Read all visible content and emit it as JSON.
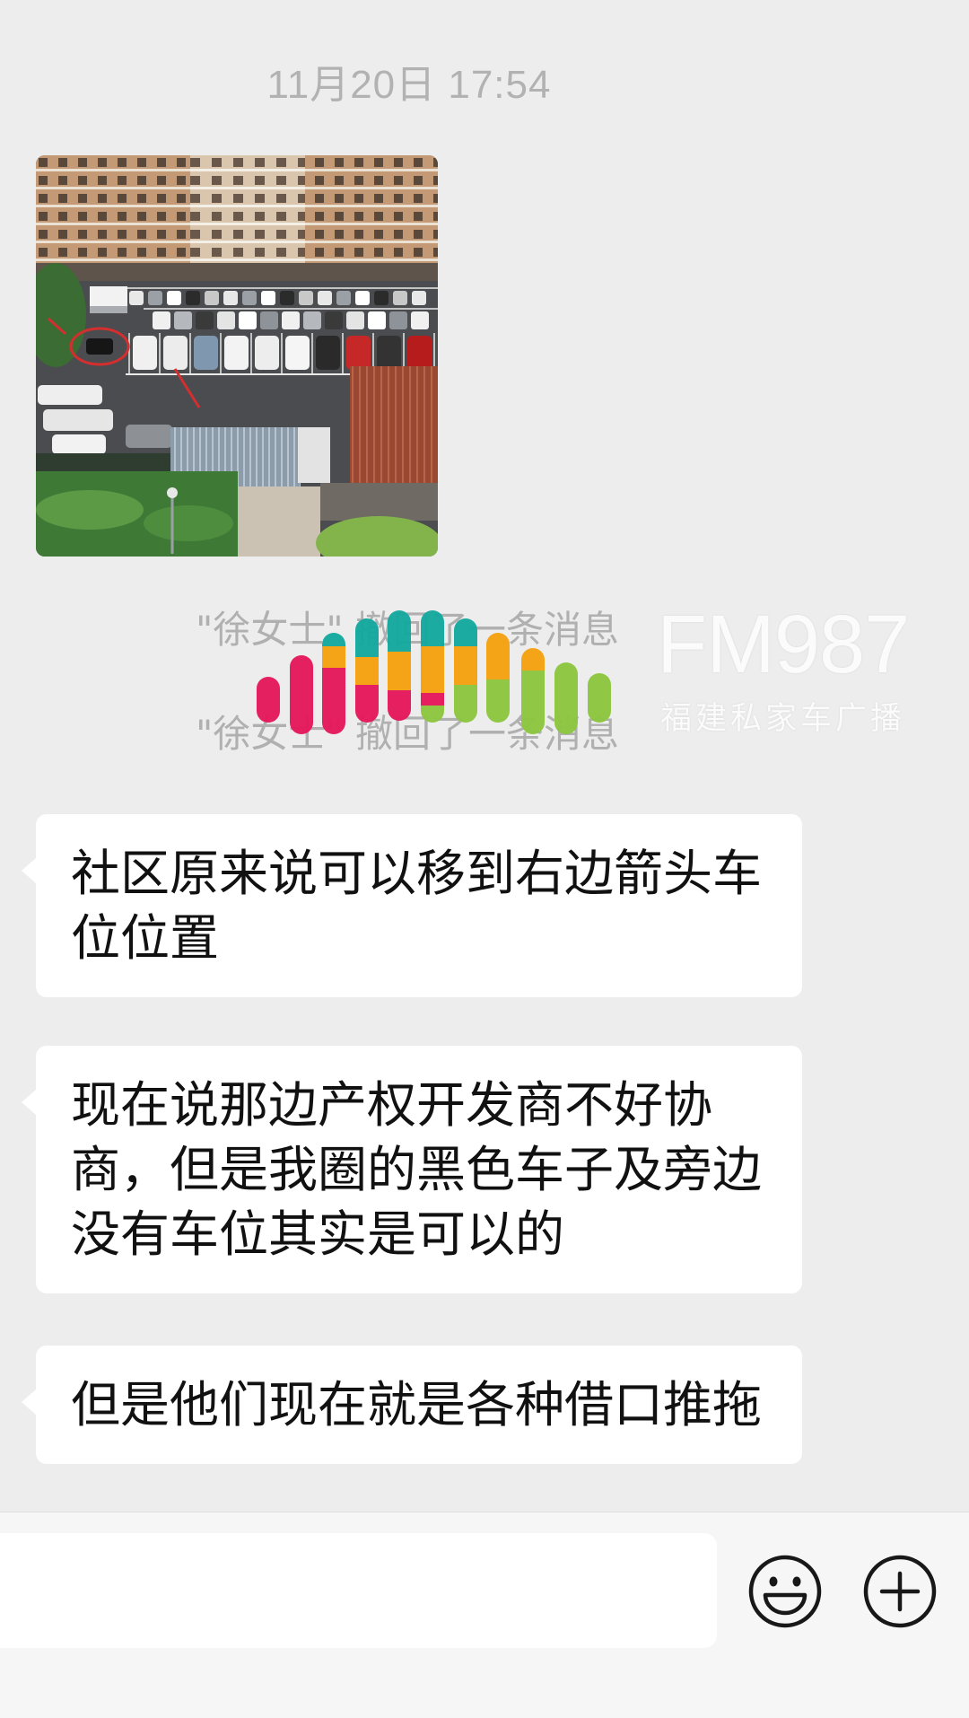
{
  "chat": {
    "timestamp": "11月20日 17:54",
    "recall_notices": [
      "\"徐女士\" 撤回了一条消息",
      "\"徐女士\" 撤回了一条消息"
    ],
    "text_messages": [
      "社区原来说可以移到右边箭头车位位置",
      "现在说那边产权开发商不好协商，但是我圈的黑色车子及旁边没有车位其实是可以的",
      "但是他们现在就是各种借口推拖"
    ]
  },
  "watermark": {
    "brand": "FM987",
    "subtitle": "福建私家车广播",
    "colors": {
      "pink": "#e5175a",
      "orange": "#f5a10f",
      "teal": "#13a89e",
      "green": "#8cc63f"
    }
  },
  "input_bar": {
    "value": "",
    "emoji_button_icon": "emoji-icon",
    "more_button_icon": "plus-icon"
  },
  "colors": {
    "background": "#ededed",
    "bubble": "#ffffff",
    "system_text": "#b2b2b2",
    "marker_red": "#d32f2f"
  }
}
